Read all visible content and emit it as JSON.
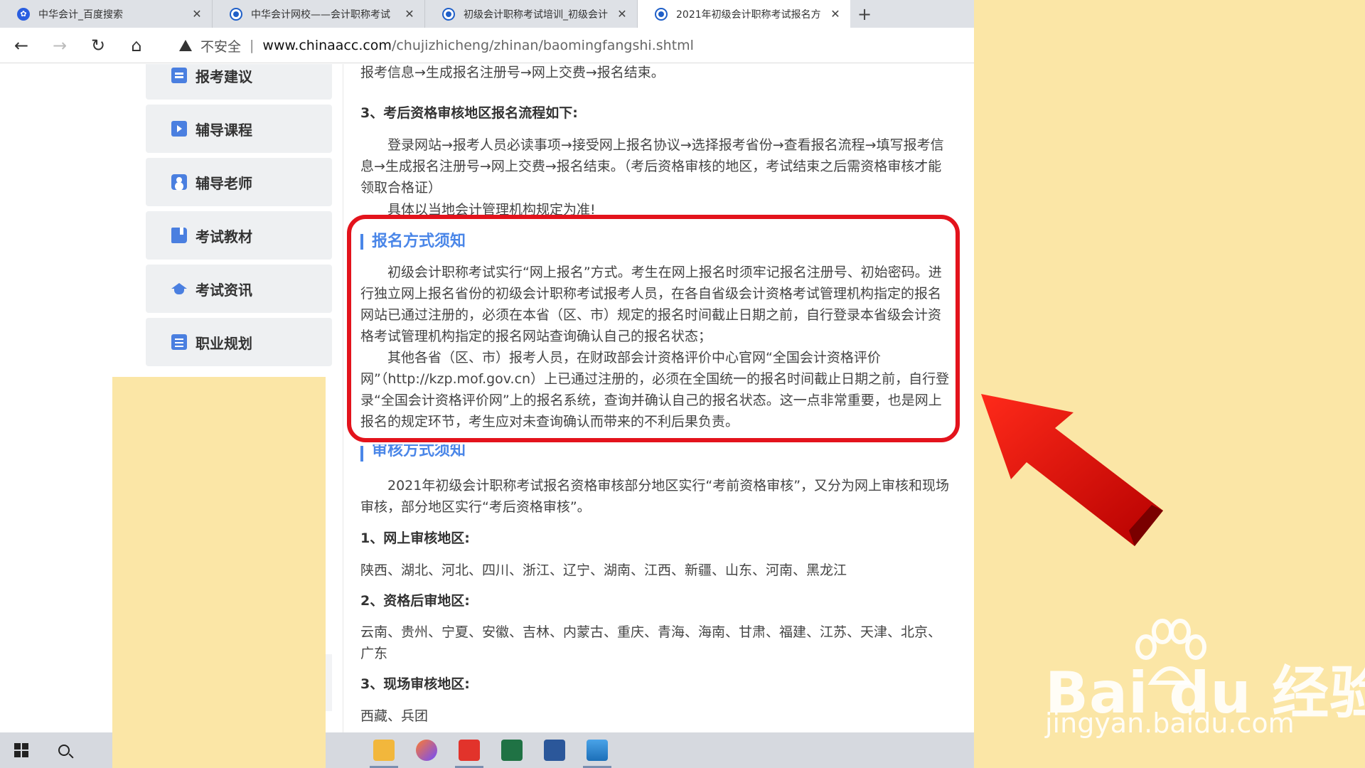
{
  "tabs": [
    {
      "title": "中华会计_百度搜索",
      "icon": "baidu-paw-icon"
    },
    {
      "title": "中华会计网校——会计职称考试",
      "icon": "chinaacc-icon"
    },
    {
      "title": "初级会计职称考试培训_初级会计",
      "icon": "chinaacc-icon"
    },
    {
      "title": "2021年初级会计职称考试报名方",
      "icon": "chinaacc-icon"
    }
  ],
  "address": {
    "security": "不安全",
    "host": "www.chinaacc.com",
    "path": "/chujizhicheng/zhinan/baomingfangshi.shtml"
  },
  "sidebar": {
    "items": [
      {
        "label": "报考建议",
        "icon": "chat-icon"
      },
      {
        "label": "辅导课程",
        "icon": "video-icon"
      },
      {
        "label": "辅导老师",
        "icon": "user-icon"
      },
      {
        "label": "考试教材",
        "icon": "book-icon"
      },
      {
        "label": "考试资讯",
        "icon": "cap-icon"
      },
      {
        "label": "职业规划",
        "icon": "list-icon"
      }
    ]
  },
  "content": {
    "line_top": "报考信息→生成报名注册号→网上交费→报名结束。",
    "sub3": "3、考后资格审核地区报名流程如下:",
    "para_after": "登录网站→报考人员必读事项→接受网上报名协议→选择报考省份→查看报名流程→填写报考信息→生成报名注册号→网上交费→报名结束。（考后资格审核的地区，考试结束之后需资格审核才能领取合格证）",
    "para_local": "具体以当地会计管理机构规定为准!",
    "section1_title": "报名方式须知",
    "section1_p1": "初级会计职称考试实行“网上报名”方式。考生在网上报名时须牢记报名注册号、初始密码。进行独立网上报名省份的初级会计职称考试报考人员，在各自省级会计资格考试管理机构指定的报名网站已通过注册的，必须在本省（区、市）规定的报名时间截止日期之前，自行登录本省级会计资格考试管理机构指定的报名网站查询确认自己的报名状态；",
    "section1_p2": "其他各省（区、市）报考人员，在财政部会计资格评价中心官网“全国会计资格评价网”（http://kzp.mof.gov.cn）上已通过注册的，必须在全国统一的报名时间截止日期之前，自行登录“全国会计资格评价网”上的报名系统，查询并确认自己的报名状态。这一点非常重要，也是网上报名的规定环节，考生应对未查询确认而带来的不利后果负责。",
    "section2_title": "审核方式须知",
    "section2_p1": "2021年初级会计职称考试报名资格审核部分地区实行“考前资格审核”，又分为网上审核和现场审核，部分地区实行“考后资格审核”。",
    "online_head": "1、网上审核地区:",
    "online_list": "陕西、湖北、河北、四川、浙江、辽宁、湖南、江西、新疆、山东、河南、黑龙江",
    "post_head": "2、资格后审地区:",
    "post_list": "云南、贵州、宁夏、安徽、吉林、内蒙古、重庆、青海、海南、甘肃、福建、江苏、天津、北京、广东",
    "onsite_head": "3、现场审核地区:",
    "onsite_list": "西藏、兵团"
  },
  "watermark": {
    "brand": "Bai du 经验",
    "sub": "jingyan.baidu.com"
  },
  "colors": {
    "highlight": "#e3131c",
    "section_title": "#4a86e8",
    "background": "#fbe6a6"
  }
}
